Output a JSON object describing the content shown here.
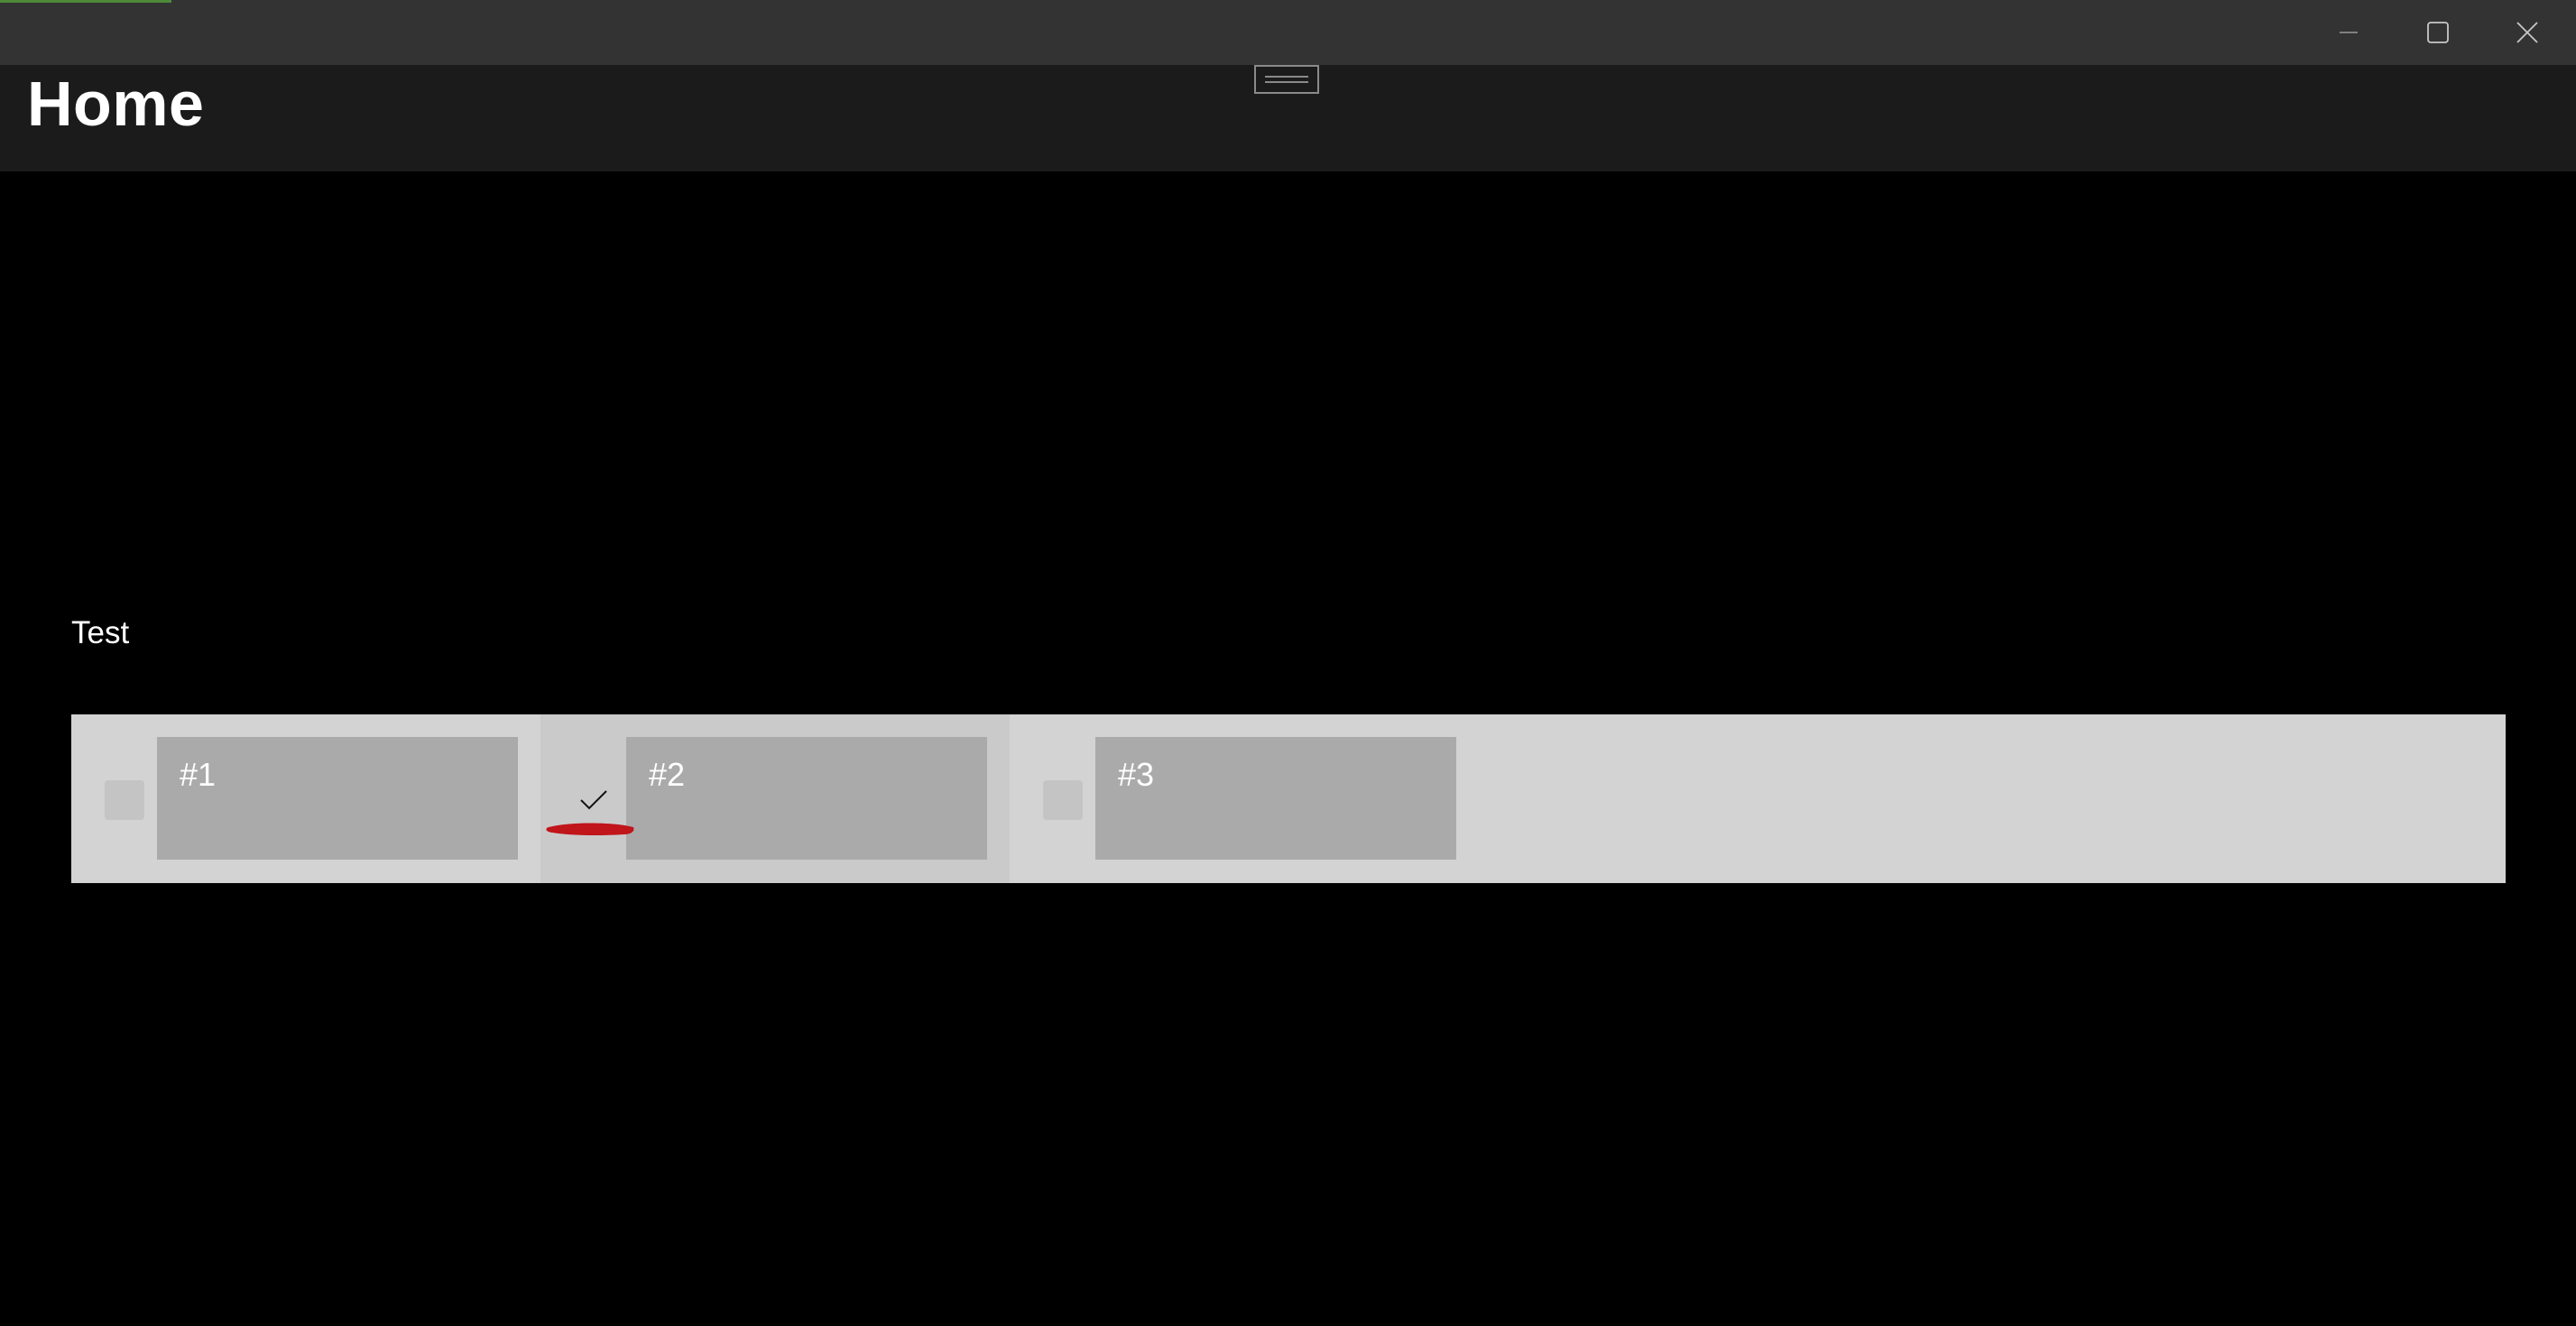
{
  "window": {
    "caption_buttons": [
      {
        "name": "minimize",
        "icon": "minimize-icon"
      },
      {
        "name": "maximize",
        "icon": "maximize-icon"
      },
      {
        "name": "close",
        "icon": "close-icon"
      }
    ]
  },
  "header": {
    "title": "Home"
  },
  "main": {
    "section_label": "Test",
    "items": [
      {
        "label": "#1",
        "checked": false
      },
      {
        "label": "#2",
        "checked": true
      },
      {
        "label": "#3",
        "checked": false
      }
    ]
  },
  "colors": {
    "titlebar": "#333333",
    "header": "#1b1b1b",
    "background": "#000000",
    "panel": "#d3d3d3",
    "card": "#aaaaaa",
    "annotation": "#c0151a"
  }
}
